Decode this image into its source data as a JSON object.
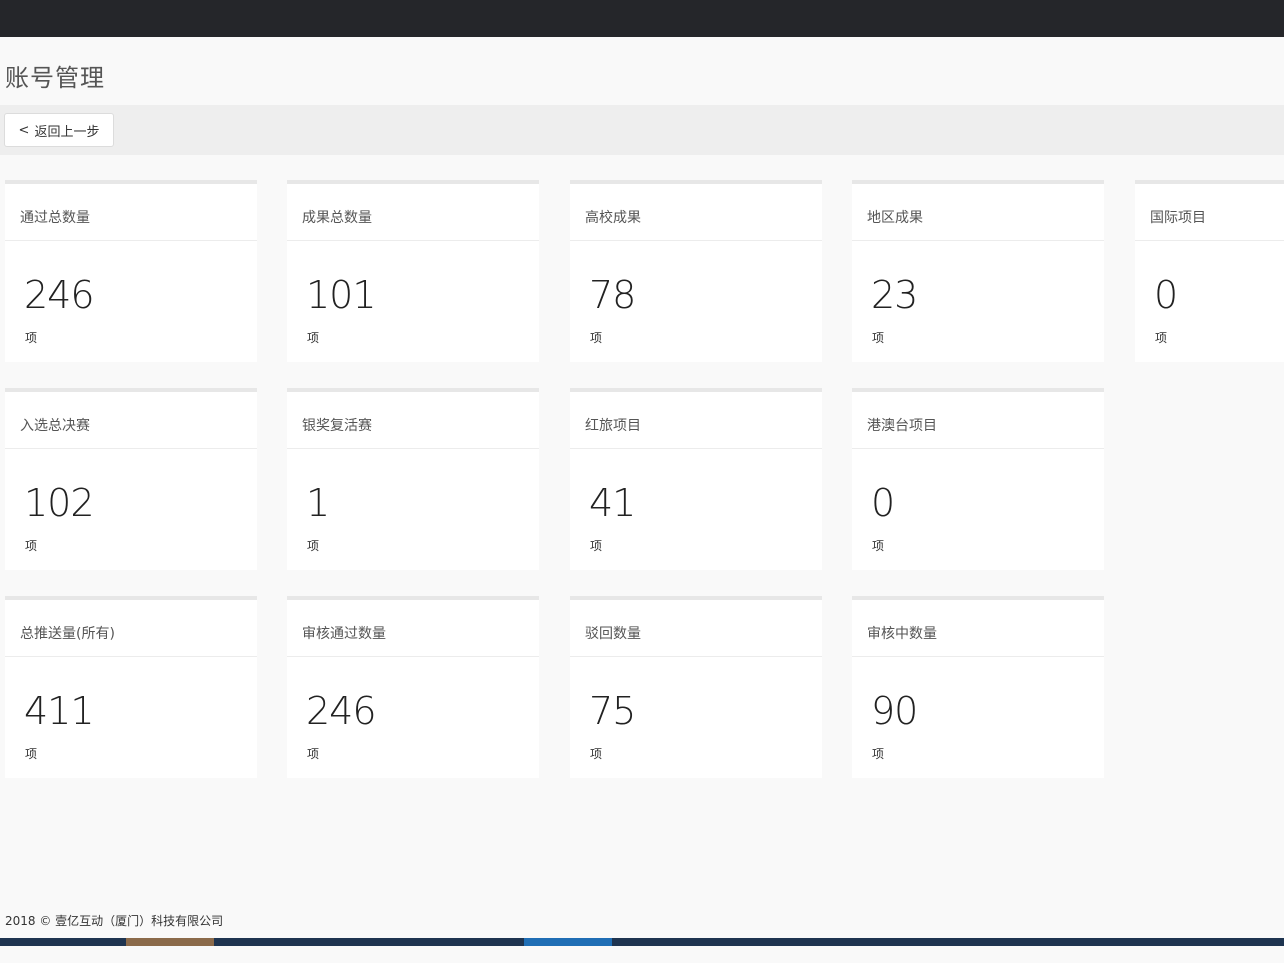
{
  "page": {
    "title": "账号管理"
  },
  "toolbar": {
    "back_label": "返回上一步",
    "back_icon": "chevron-left-icon"
  },
  "cards": [
    {
      "label": "通过总数量",
      "value": "246",
      "unit": "项"
    },
    {
      "label": "成果总数量",
      "value": "101",
      "unit": "项"
    },
    {
      "label": "高校成果",
      "value": "78",
      "unit": "项"
    },
    {
      "label": "地区成果",
      "value": "23",
      "unit": "项"
    },
    {
      "label": "国际项目",
      "value": "0",
      "unit": "项"
    },
    {
      "label": "入选总决赛",
      "value": "102",
      "unit": "项"
    },
    {
      "label": "银奖复活赛",
      "value": "1",
      "unit": "项"
    },
    {
      "label": "红旅项目",
      "value": "41",
      "unit": "项"
    },
    {
      "label": "港澳台项目",
      "value": "0",
      "unit": "项"
    },
    {
      "label": "总推送量(所有)",
      "value": "411",
      "unit": "项"
    },
    {
      "label": "审核通过数量",
      "value": "246",
      "unit": "项"
    },
    {
      "label": "驳回数量",
      "value": "75",
      "unit": "项"
    },
    {
      "label": "审核中数量",
      "value": "90",
      "unit": "项"
    }
  ],
  "footer": {
    "text": "2018 © 壹亿互动（厦门）科技有限公司"
  },
  "colors": {
    "topbar": "#25262a",
    "toolbar": "#eeeeee",
    "bottombar": "#1e3450"
  }
}
